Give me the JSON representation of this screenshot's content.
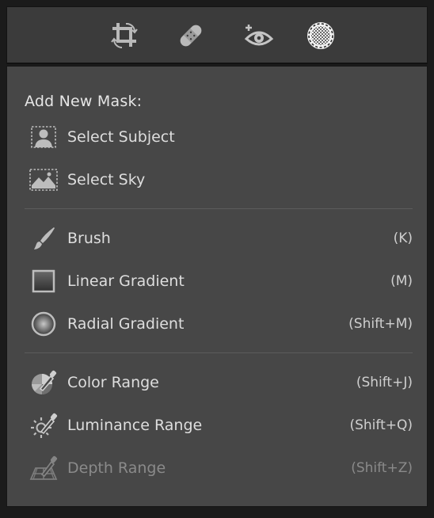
{
  "toolbar": {
    "tools": [
      {
        "icon": "crop-icon"
      },
      {
        "icon": "healing-bandage-icon"
      },
      {
        "icon": "red-eye-icon"
      },
      {
        "icon": "masking-icon",
        "active": true
      }
    ]
  },
  "panel": {
    "heading": "Add New Mask:",
    "groups": [
      {
        "items": [
          {
            "label": "Select Subject",
            "icon": "select-subject-icon",
            "shortcut": ""
          },
          {
            "label": "Select Sky",
            "icon": "select-sky-icon",
            "shortcut": ""
          }
        ]
      },
      {
        "items": [
          {
            "label": "Brush",
            "icon": "brush-icon",
            "shortcut": "(K)"
          },
          {
            "label": "Linear Gradient",
            "icon": "linear-gradient-icon",
            "shortcut": "(M)"
          },
          {
            "label": "Radial Gradient",
            "icon": "radial-gradient-icon",
            "shortcut": "(Shift+M)"
          }
        ]
      },
      {
        "items": [
          {
            "label": "Color Range",
            "icon": "color-range-icon",
            "shortcut": "(Shift+J)"
          },
          {
            "label": "Luminance Range",
            "icon": "luminance-range-icon",
            "shortcut": "(Shift+Q)"
          },
          {
            "label": "Depth Range",
            "icon": "depth-range-icon",
            "shortcut": "(Shift+Z)",
            "disabled": true
          }
        ]
      }
    ]
  },
  "colors": {
    "toolbar_bg": "#3b3b3b",
    "panel_bg": "#474747",
    "text": "#dedede",
    "disabled_text": "#8a8a8a",
    "icon": "#bfbfbf"
  }
}
